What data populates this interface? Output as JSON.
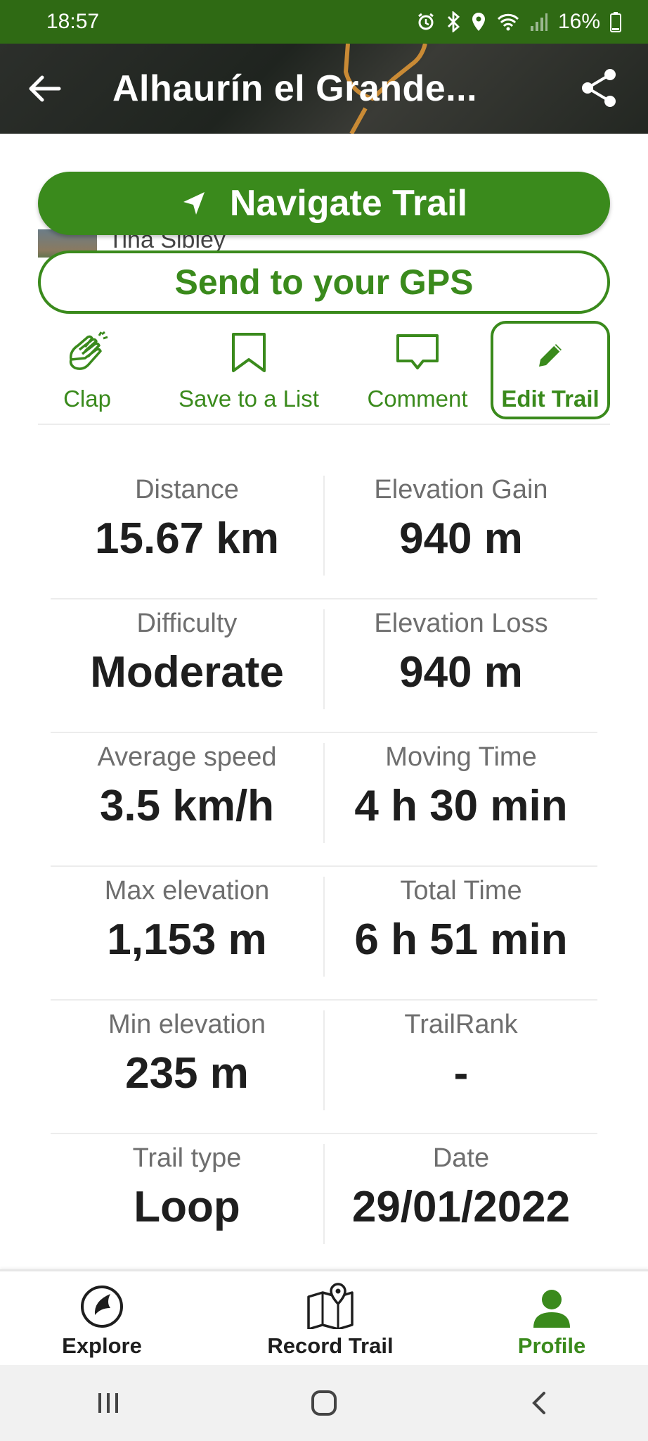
{
  "status_bar": {
    "time": "18:57",
    "battery": "16%"
  },
  "header": {
    "title": "Alhaurín el Grande..."
  },
  "buttons": {
    "navigate": "Navigate Trail",
    "send_gps": "Send to your GPS"
  },
  "author": {
    "name": "Tina Sibley"
  },
  "actions": {
    "clap": "Clap",
    "save": "Save to a List",
    "comment": "Comment",
    "edit": "Edit Trail"
  },
  "stats": [
    {
      "left": {
        "label": "Distance",
        "value": "15.67 km"
      },
      "right": {
        "label": "Elevation Gain",
        "value": "940 m"
      }
    },
    {
      "left": {
        "label": "Difficulty",
        "value": "Moderate"
      },
      "right": {
        "label": "Elevation Loss",
        "value": "940 m"
      }
    },
    {
      "left": {
        "label": "Average speed",
        "value": "3.5 km/h"
      },
      "right": {
        "label": "Moving Time",
        "value": "4 h 30 min"
      }
    },
    {
      "left": {
        "label": "Max elevation",
        "value": "1,153 m"
      },
      "right": {
        "label": "Total Time",
        "value": "6 h 51 min"
      }
    },
    {
      "left": {
        "label": "Min elevation",
        "value": "235 m"
      },
      "right": {
        "label": "TrailRank",
        "value": "-"
      }
    },
    {
      "left": {
        "label": "Trail type",
        "value": "Loop"
      },
      "right": {
        "label": "Date",
        "value": "29/01/2022"
      }
    }
  ],
  "bottom_nav": {
    "explore": "Explore",
    "record": "Record Trail",
    "profile": "Profile"
  },
  "colors": {
    "brand_green": "#3a8a1c",
    "status_bar": "#2f6a14"
  }
}
